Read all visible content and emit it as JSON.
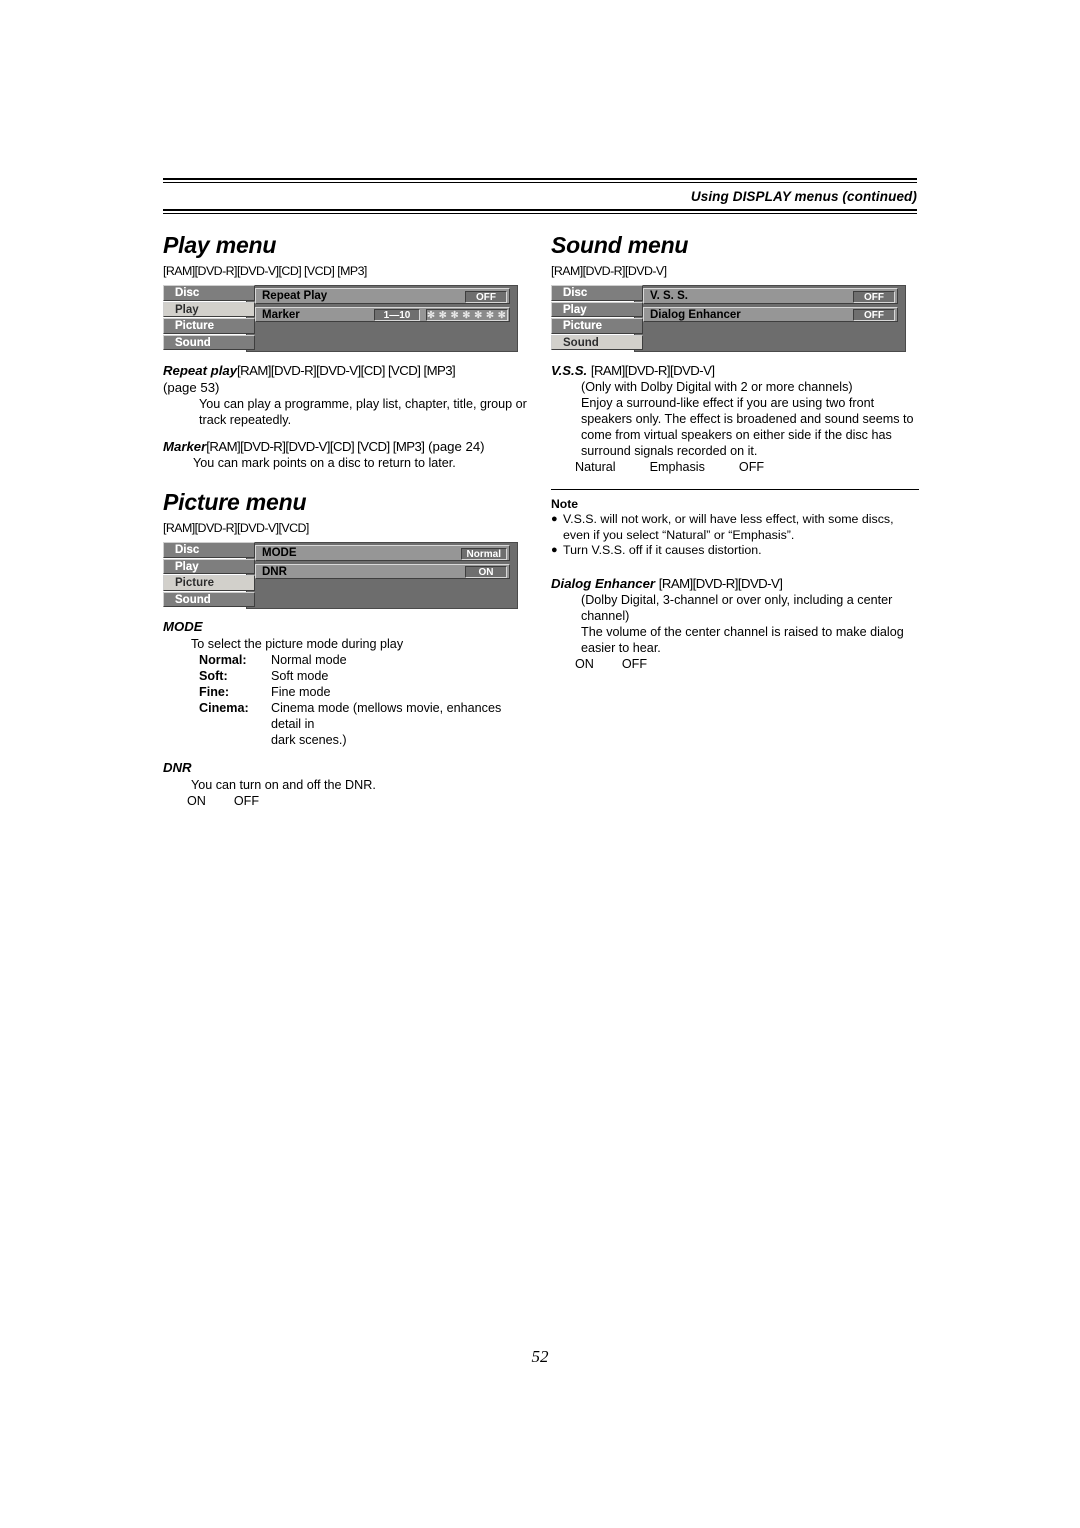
{
  "header": {
    "title": "Using DISPLAY menus (continued)"
  },
  "folio": "52",
  "left_column": {
    "play_menu": {
      "title": "Play menu",
      "disc_tags": "[RAM][DVD-R][DVD-V][CD] [VCD] [MP3]",
      "osd": {
        "tabs": [
          "Disc",
          "Play",
          "Picture",
          "Sound"
        ],
        "active_tab": "Play",
        "rows": [
          {
            "label": "Repeat Play",
            "value": "OFF"
          },
          {
            "label": "Marker",
            "number": "1—10",
            "stars": "✻ ✻ ✻ ✻ ✻ ✻ ✻ ✻ ✻ ✻"
          }
        ]
      },
      "entries": [
        {
          "lead": "Repeat play",
          "tags": "[RAM][DVD-R][DVD-V][CD] [VCD] [MP3]",
          "plain": "(page 53)",
          "body": "You can play a programme, play list, chapter, title, group or track repeatedly."
        },
        {
          "lead": "Marker",
          "tags": "[RAM][DVD-R][DVD-V][CD] [VCD] [MP3]",
          "plain": "(page 24)",
          "body": "You can mark points on a disc to return to later."
        }
      ]
    },
    "picture_menu": {
      "title": "Picture menu",
      "disc_tags": "[RAM][DVD-R][DVD-V][VCD]",
      "osd": {
        "tabs": [
          "Disc",
          "Play",
          "Picture",
          "Sound"
        ],
        "active_tab": "Picture",
        "rows": [
          {
            "label": "MODE",
            "value": "Normal"
          },
          {
            "label": "DNR",
            "value": "ON"
          }
        ]
      },
      "mode": {
        "title": "MODE",
        "intro": "To select the picture mode during play",
        "options": [
          {
            "term": "Normal:",
            "desc": "Normal mode",
            "cont": ""
          },
          {
            "term": "Soft:",
            "desc": "Soft mode",
            "cont": ""
          },
          {
            "term": "Fine:",
            "desc": "Fine mode",
            "cont": ""
          },
          {
            "term": "Cinema:",
            "desc": "Cinema mode (mellows movie, enhances detail in",
            "cont": "dark scenes.)"
          }
        ]
      },
      "dnr": {
        "title": "DNR",
        "intro": "You can turn on and off the DNR.",
        "option_on": "ON",
        "option_off": "OFF"
      }
    }
  },
  "right_column": {
    "sound_menu": {
      "title": "Sound menu",
      "disc_tags": "[RAM][DVD-R][DVD-V]",
      "osd": {
        "tabs": [
          "Disc",
          "Play",
          "Picture",
          "Sound"
        ],
        "active_tab": "Sound",
        "rows": [
          {
            "label": "V. S. S.",
            "value": "OFF"
          },
          {
            "label": "Dialog Enhancer",
            "value": "OFF"
          }
        ]
      },
      "vss": {
        "lead": "V.S.S.",
        "tags": "[RAM][DVD-R][DVD-V]",
        "body_line1": "(Only with Dolby Digital with 2 or more channels)",
        "body_line2": "Enjoy a surround-like effect if you are using two front speakers only. The effect is broadened and sound seems to come from virtual speakers on either side if the disc has surround signals recorded on it.",
        "option_1": "Natural",
        "option_2": "Emphasis",
        "option_3": "OFF"
      },
      "note": {
        "label": "Note",
        "items": [
          "V.S.S. will not work, or will have less effect, with some discs, even if you select “Natural” or “Emphasis”.",
          "Turn V.S.S. off if it causes distortion."
        ]
      },
      "dialog_enhancer": {
        "lead": "Dialog Enhancer",
        "tags": "[RAM][DVD-R][DVD-V]",
        "body_line1": "(Dolby Digital, 3-channel or over only, including a center channel)",
        "body_line2": "The volume of the center channel is raised to make dialog easier to hear.",
        "option_on": "ON",
        "option_off": "OFF"
      }
    }
  },
  "colors": {
    "osd_body": "#6d6d6d",
    "osd_tab": "#7e7e7e",
    "osd_tab_active": "#d2d0cb",
    "osd_row": "#969696",
    "osd_value": "#6f6f6f"
  }
}
